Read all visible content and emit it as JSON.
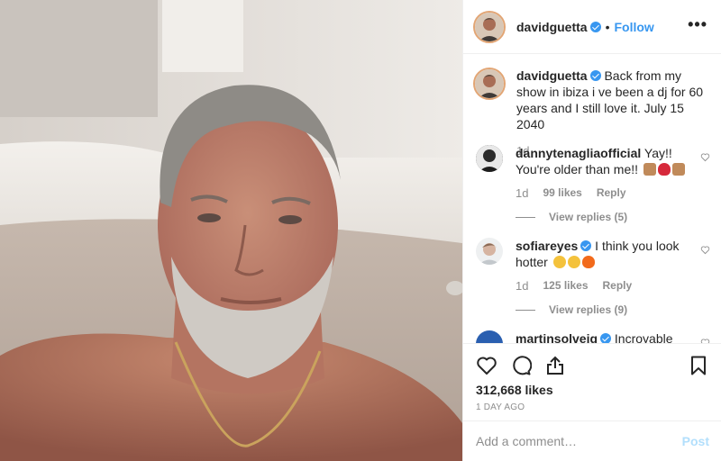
{
  "post": {
    "username": "davidguetta",
    "separator": "•",
    "follow_label": "Follow",
    "more_label": "•••",
    "caption": "Back from my show in ibiza i ve been a dj for 60 years and I still love it. July 15 2040",
    "caption_age": "1d",
    "likes": "312,668 likes",
    "date": "1 DAY AGO",
    "add_comment_placeholder": "Add a comment…",
    "post_label": "Post"
  },
  "comments": [
    {
      "username": "dannytenagliaofficial",
      "text": "Yay!! You're older than me!!",
      "emojis": [
        "thumbs-up",
        "heart",
        "thumbs-up"
      ],
      "age": "1d",
      "likes": "99 likes",
      "reply_label": "Reply",
      "view_replies": "View replies (5)"
    },
    {
      "username": "sofiareyes",
      "text": "I think you look hotter",
      "emojis": [
        "laughing",
        "laughing",
        "fire"
      ],
      "age": "1d",
      "likes": "125 likes",
      "reply_label": "Reply",
      "view_replies": "View replies (9)"
    },
    {
      "username": "martinsolveig",
      "text": "Incroyable"
    }
  ],
  "icons": [
    "heart-icon",
    "comment-icon",
    "share-icon",
    "bookmark-icon",
    "more-icon",
    "verified-icon"
  ],
  "colors": {
    "link": "#3897f0",
    "muted": "#8e8e8e",
    "text": "#262626",
    "post_disabled": "#b2dffc"
  }
}
